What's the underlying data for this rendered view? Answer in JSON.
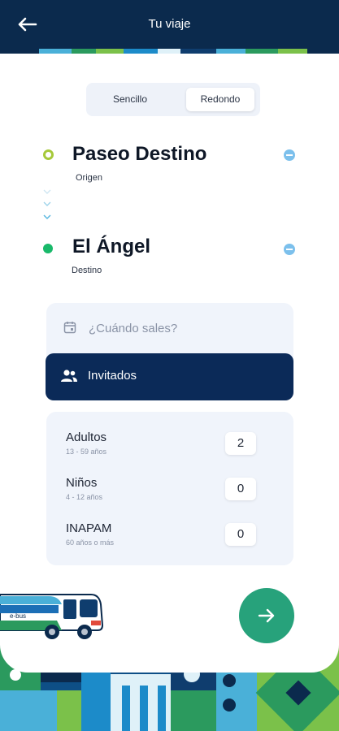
{
  "header": {
    "title": "Tu viaje",
    "back_icon": "arrow-left-icon"
  },
  "trip_type": {
    "options": [
      "Sencillo",
      "Redondo"
    ],
    "selected": "Redondo"
  },
  "origin": {
    "name": "Paseo Destino",
    "label": "Origen",
    "icon": "origin-ring-icon",
    "remove_icon": "minus-circle-icon"
  },
  "destination": {
    "name": "El Ángel",
    "label": "Destino",
    "icon": "destination-dot-icon",
    "remove_icon": "minus-circle-icon"
  },
  "date": {
    "placeholder": "¿Cuándo sales?",
    "icon": "calendar-icon"
  },
  "guests": {
    "label": "Invitados",
    "icon": "people-icon"
  },
  "passengers": [
    {
      "label": "Adultos",
      "range": "13 - 59 años",
      "count": "2"
    },
    {
      "label": "Niños",
      "range": "4 - 12 años",
      "count": "0"
    },
    {
      "label": "INAPAM",
      "range": "60 años o más",
      "count": "0"
    }
  ],
  "bus_brand": "e-bus",
  "next_icon": "arrow-right-icon",
  "colors": {
    "header": "#0b2a4d",
    "accent_button": "#27a27b",
    "guests_button": "#0b2a58",
    "origin_ring": "#a6c93a",
    "destination_dot": "#19b96a",
    "remove": "#7cc0ec"
  }
}
